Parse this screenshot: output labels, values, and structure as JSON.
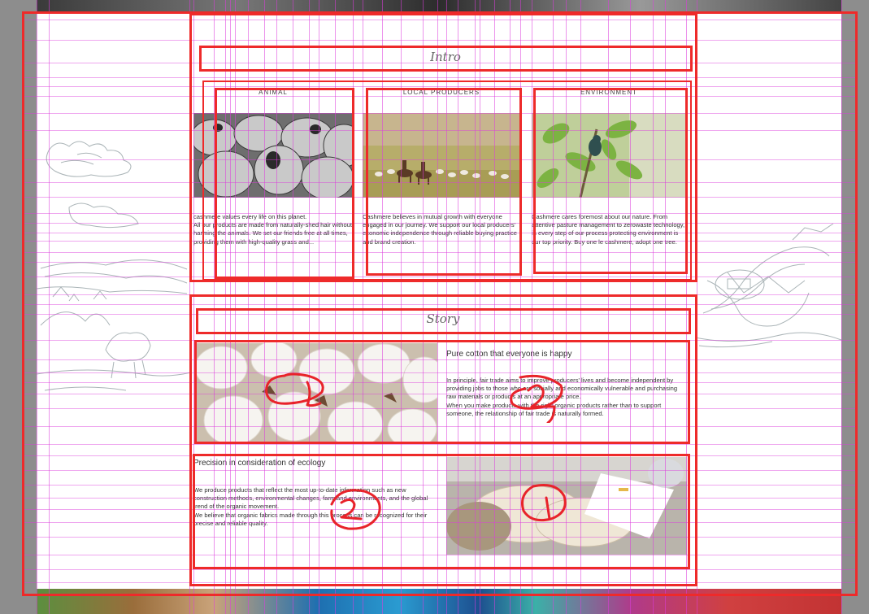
{
  "intro": {
    "title": "Intro",
    "columns": [
      {
        "heading": "ANIMAL",
        "text": "cashmere values every life on this planet.\nAll our products are made from naturally-shed hair without harming the animals. We set our friends free at all times, providing them with high-quality grass and..."
      },
      {
        "heading": "LOCAL PRODUCERS",
        "text": "Cashmere believes in mutual growth with everyone engaged in our journey. We support our local producers' economic independence through reliable buying practice and brand creation."
      },
      {
        "heading": "ENVIRONMENT",
        "text": "Cashmere cares foremost about our nature. From attentive pasture management to zerowaste technology, in every step of our process protecting environment is our top priority. Buy one le cashmere, adopt one tree."
      }
    ]
  },
  "story": {
    "title": "Story",
    "block1": {
      "headline": "Pure cotton that everyone is happy",
      "text": "In principle, fair trade aims to improve producers' lives and become independent by providing jobs to those who are socially and economically vulnerable and purchasing raw materials or products at an appropriate price.\nWhen you make products with the right organic products rather than to support someone, the relationship of fair trade is naturally formed."
    },
    "block2": {
      "headline": "Precision in consideration of ecology",
      "text": "We produce products that reflect the most up-to-date information such as new construction methods, environmental changes, farmland environments, and the global trend of the organic movement.\nWe believe that organic fabrics made through this process can be recognized for their precise and reliable quality."
    }
  },
  "annotations": {
    "marks": [
      "1",
      "2",
      "2",
      "1"
    ],
    "color": "#ee2a2a"
  }
}
